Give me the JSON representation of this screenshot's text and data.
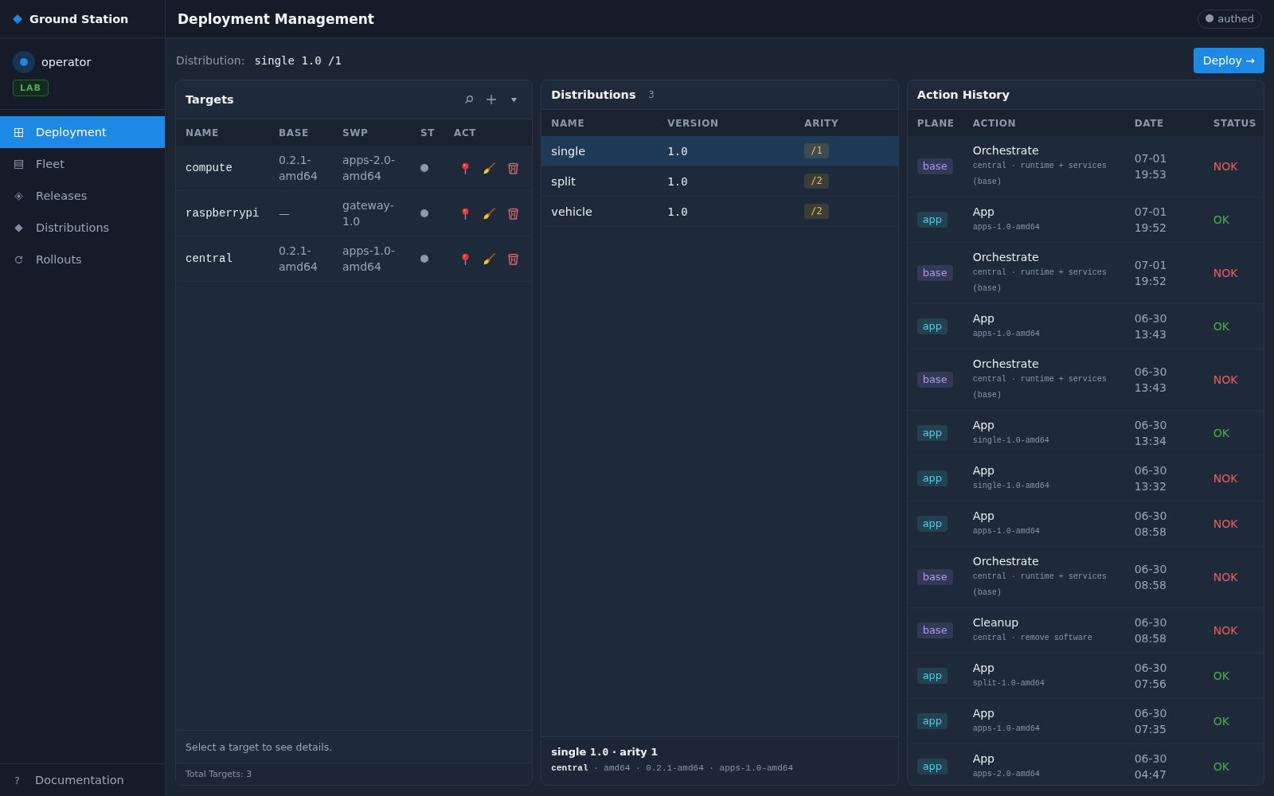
{
  "sidebar": {
    "brand": "Ground Station",
    "user": {
      "name": "operator",
      "badge": "LAB"
    },
    "nav": [
      {
        "label": "Deployment",
        "selected": true
      },
      {
        "label": "Fleet",
        "selected": false
      },
      {
        "label": "Releases",
        "selected": false
      },
      {
        "label": "Distributions",
        "selected": false
      },
      {
        "label": "Rollouts",
        "selected": false
      }
    ],
    "footer_link": {
      "label": "Documentation",
      "glyph": "?"
    }
  },
  "header": {
    "title": "Deployment Management",
    "session": "authed"
  },
  "toolbar": {
    "label": "Distribution:",
    "value": "single 1.0 /1",
    "action": "Deploy →"
  },
  "targets": {
    "title": "Targets",
    "tools": [
      {
        "kind": "search"
      },
      {
        "kind": "add"
      },
      {
        "kind": "menu"
      }
    ],
    "columns": [
      "NAME",
      "BASE",
      "SWP",
      "ST",
      "ACT"
    ],
    "rows": [
      {
        "name": "compute",
        "base": "0.2.1-amd64",
        "swp": "apps-2.0-amd64",
        "color": "#8f9aa6"
      },
      {
        "name": "raspberrypi",
        "base": "—",
        "swp": "gateway-1.0",
        "color": "#8f9aa6"
      },
      {
        "name": "central",
        "base": "0.2.1-amd64",
        "swp": "apps-1.0-amd64",
        "color": "#8f9aa6"
      }
    ],
    "hint": "Select a target to see details.",
    "total": "Total Targets: 3"
  },
  "distributions": {
    "title": "Distributions",
    "count": "3",
    "columns": [
      "NAME",
      "VERSION",
      "ARITY"
    ],
    "rows": [
      {
        "name": "single",
        "version": "1.0",
        "arity": "/1",
        "selected": true
      },
      {
        "name": "split",
        "version": "1.0",
        "arity": "/2",
        "selected": false
      },
      {
        "name": "vehicle",
        "version": "1.0",
        "arity": "/2",
        "selected": false
      }
    ],
    "detail": {
      "name": "single",
      "version": "1.0",
      "arity": "· arity 1",
      "path": "**central** · amd64 · 0.2.1-amd64 · apps-1.0-amd64"
    }
  },
  "history": {
    "title": "Action History",
    "columns": [
      "PLANE",
      "ACTION",
      "DATE",
      "STATUS"
    ],
    "rows": [
      {
        "plane": "base",
        "color": "#ab98f2",
        "action": "Orchestrate",
        "detail": "central · runtime + services (base)",
        "date": "07-01 19:53",
        "status": "NOK",
        "ok": false
      },
      {
        "plane": "app",
        "color": "#4dd0e1",
        "action": "App",
        "detail": "apps-1.0-amd64",
        "date": "07-01 19:52",
        "status": "OK",
        "ok": true
      },
      {
        "plane": "base",
        "color": "#ab98f2",
        "action": "Orchestrate",
        "detail": "central · runtime + services (base)",
        "date": "07-01 19:52",
        "status": "NOK",
        "ok": false
      },
      {
        "plane": "app",
        "color": "#4dd0e1",
        "action": "App",
        "detail": "apps-1.0-amd64",
        "date": "06-30 13:43",
        "status": "OK",
        "ok": true
      },
      {
        "plane": "base",
        "color": "#ab98f2",
        "action": "Orchestrate",
        "detail": "central · runtime + services (base)",
        "date": "06-30 13:43",
        "status": "NOK",
        "ok": false
      },
      {
        "plane": "app",
        "color": "#4dd0e1",
        "action": "App",
        "detail": "single-1.0-amd64",
        "date": "06-30 13:34",
        "status": "OK",
        "ok": true
      },
      {
        "plane": "app",
        "color": "#4dd0e1",
        "action": "App",
        "detail": "single-1.0-amd64",
        "date": "06-30 13:32",
        "status": "NOK",
        "ok": false
      },
      {
        "plane": "app",
        "color": "#4dd0e1",
        "action": "App",
        "detail": "apps-1.0-amd64",
        "date": "06-30 08:58",
        "status": "NOK",
        "ok": false
      },
      {
        "plane": "base",
        "color": "#ab98f2",
        "action": "Orchestrate",
        "detail": "central · runtime + services (base)",
        "date": "06-30 08:58",
        "status": "NOK",
        "ok": false
      },
      {
        "plane": "base",
        "color": "#ab98f2",
        "action": "Cleanup",
        "detail": "central · remove software",
        "date": "06-30 08:58",
        "status": "NOK",
        "ok": false
      },
      {
        "plane": "app",
        "color": "#4dd0e1",
        "action": "App",
        "detail": "split-1.0-amd64",
        "date": "06-30 07:56",
        "status": "OK",
        "ok": true
      },
      {
        "plane": "app",
        "color": "#4dd0e1",
        "action": "App",
        "detail": "apps-1.0-amd64",
        "date": "06-30 07:35",
        "status": "OK",
        "ok": true
      },
      {
        "plane": "app",
        "color": "#4dd0e1",
        "action": "App",
        "detail": "apps-2.0-amd64",
        "date": "06-30 04:47",
        "status": "OK",
        "ok": true
      }
    ]
  }
}
